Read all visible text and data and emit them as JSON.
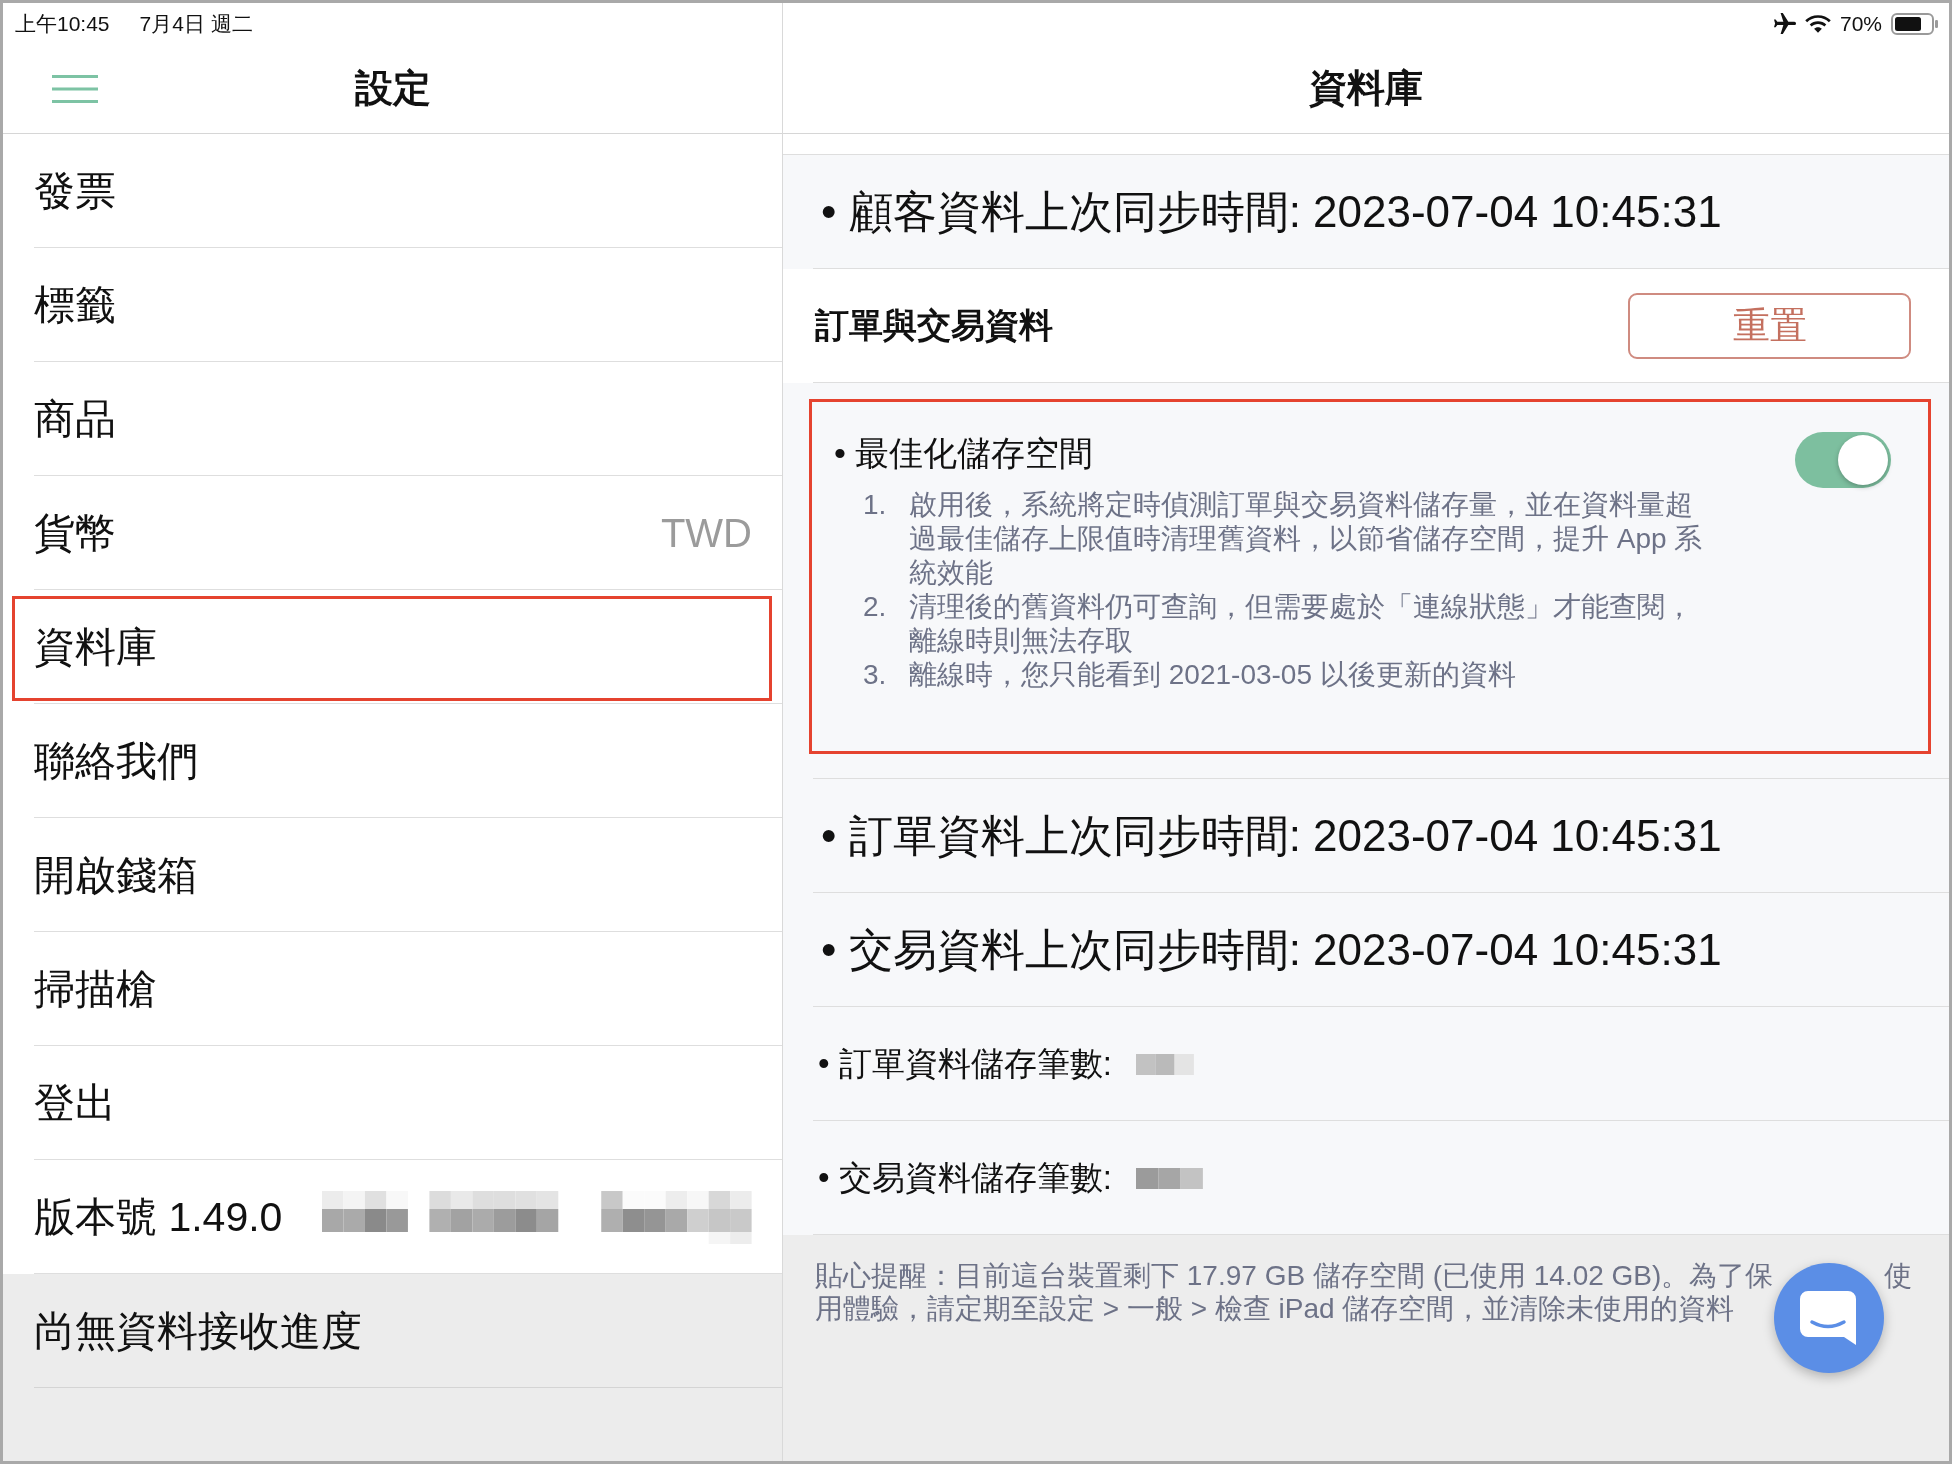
{
  "status_bar": {
    "time": "上午10:45",
    "date": "7月4日 週二",
    "battery": "70%"
  },
  "sidebar": {
    "title": "設定",
    "items": [
      {
        "kind": "plain",
        "label": "發票",
        "highlighted": false
      },
      {
        "kind": "plain",
        "label": "標籤",
        "highlighted": false
      },
      {
        "kind": "plain",
        "label": "商品",
        "highlighted": false
      },
      {
        "kind": "value",
        "label": "貨幣",
        "value": "TWD",
        "highlighted": false
      },
      {
        "kind": "plain",
        "label": "資料庫",
        "highlighted": true
      },
      {
        "kind": "plain",
        "label": "聯絡我們",
        "highlighted": false
      },
      {
        "kind": "plain",
        "label": "開啟錢箱",
        "highlighted": false
      },
      {
        "kind": "plain",
        "label": "掃描槍",
        "highlighted": false
      },
      {
        "kind": "plain",
        "label": "登出",
        "highlighted": false
      },
      {
        "kind": "version",
        "label": "版本號 1.49.0",
        "highlighted": false
      }
    ],
    "progress": "尚無資料接收進度"
  },
  "detail": {
    "title": "資料庫",
    "rows": [
      {
        "kind": "sync",
        "label": "• 顧客資料上次同步時間: 2023-07-04 10:45:31",
        "highlighted": false
      },
      {
        "kind": "group",
        "label": "訂單與交易資料",
        "button": "重置",
        "highlighted": false
      },
      {
        "kind": "toggle",
        "label": "• 最佳化儲存空間",
        "on": true,
        "highlighted": true,
        "notes": [
          {
            "number": "1.",
            "text": "啟用後，系統將定時偵測訂單與交易資料儲存量，並在資料量超過最佳儲存上限值時清理舊資料，以節省儲存空間，提升 App 系統效能"
          },
          {
            "number": "2.",
            "text": "清理後的舊資料仍可查詢，但需要處於「連線狀態」才能查閱，離線時則無法存取"
          },
          {
            "number": "3.",
            "text": "離線時，您只能看到 2021-03-05 以後更新的資料"
          }
        ]
      },
      {
        "kind": "sync",
        "label": "• 訂單資料上次同步時間: 2023-07-04 10:45:31",
        "highlighted": false
      },
      {
        "kind": "sync",
        "label": "• 交易資料上次同步時間: 2023-07-04 10:45:31",
        "highlighted": false
      },
      {
        "kind": "count",
        "label": "• 訂單資料儲存筆數:",
        "highlighted": false
      },
      {
        "kind": "count",
        "label": "• 交易資料儲存筆數:",
        "highlighted": false
      }
    ],
    "tip": [
      "貼心提醒：目前這台裝置剩下 17.97 GB 儲存空間 (已使用 14.02 GB)。為了保",
      "使",
      "用體驗，請定期至設定 > 一般 > 檢查 iPad 儲存空間，並清除未使用的資料"
    ]
  }
}
